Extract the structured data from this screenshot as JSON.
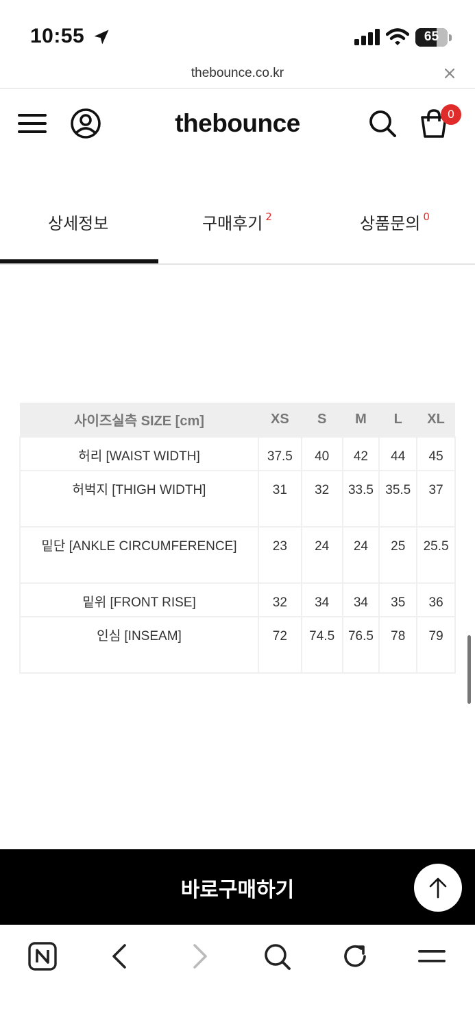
{
  "status_bar": {
    "time": "10:55",
    "battery_level": "65",
    "icons": [
      "location-arrow-icon",
      "cellular-signal-icon",
      "wifi-icon",
      "battery-icon"
    ]
  },
  "url_bar": {
    "url": "thebounce.co.kr",
    "close_icon": "close-icon"
  },
  "header": {
    "brand": "thebounce",
    "cart_count": "0",
    "icons": [
      "hamburger-menu-icon",
      "user-account-icon",
      "search-icon",
      "cart-icon"
    ]
  },
  "tabs": [
    {
      "label": "상세정보",
      "count": "",
      "active": true
    },
    {
      "label": "구매후기",
      "count": "2",
      "active": false
    },
    {
      "label": "상품문의",
      "count": "0",
      "active": false
    }
  ],
  "size_table": {
    "headers": [
      "사이즈실측 SIZE [cm]",
      "XS",
      "S",
      "M",
      "L",
      "XL"
    ],
    "rows": [
      {
        "label": "허리 [WAIST WIDTH]",
        "values": [
          "37.5",
          "40",
          "42",
          "44",
          "45"
        ]
      },
      {
        "label": "허벅지 [THIGH WIDTH]",
        "values": [
          "31",
          "32",
          "33.5",
          "35.5",
          "37"
        ]
      },
      {
        "label": "밑단 [ANKLE CIRCUMFERENCE]",
        "values": [
          "23",
          "24",
          "24",
          "25",
          "25.5"
        ]
      },
      {
        "label": "밑위 [FRONT RISE]",
        "values": [
          "32",
          "34",
          "34",
          "35",
          "36"
        ]
      },
      {
        "label": "인심 [INSEAM]",
        "values": [
          "72",
          "74.5",
          "76.5",
          "78",
          "79"
        ]
      }
    ]
  },
  "buy_button": {
    "label": "바로구매하기"
  },
  "colors": {
    "accent_red": "#e02b2b",
    "buy_bar": "#000000",
    "table_header_bg": "#eeeeee"
  },
  "browser_toolbar": {
    "icons": [
      "naver-home-icon",
      "back-icon",
      "forward-icon",
      "search-icon",
      "reload-icon",
      "menu-icon"
    ]
  }
}
